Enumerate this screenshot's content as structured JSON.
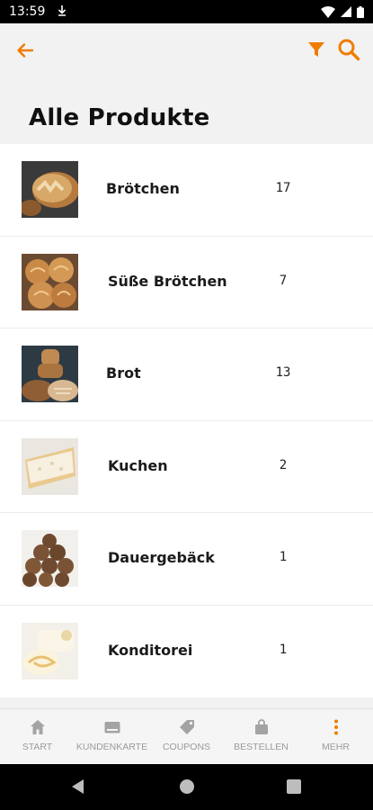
{
  "status": {
    "time": "13:59",
    "download_icon": "download-icon"
  },
  "colors": {
    "accent": "#f07c00",
    "title": "#111111"
  },
  "header": {
    "title": "Alle Produkte"
  },
  "categories": [
    {
      "label": "Brötchen",
      "count": "17",
      "image": "bread-rolls"
    },
    {
      "label": "Süße Brötchen",
      "count": "7",
      "image": "sweet-buns"
    },
    {
      "label": "Brot",
      "count": "13",
      "image": "bread-loaves"
    },
    {
      "label": "Kuchen",
      "count": "2",
      "image": "cake"
    },
    {
      "label": "Dauergebäck",
      "count": "1",
      "image": "cookies"
    },
    {
      "label": "Konditorei",
      "count": "1",
      "image": "pastry-roll"
    }
  ],
  "nav": {
    "items": [
      {
        "label": "START",
        "icon": "home-icon"
      },
      {
        "label": "KUNDENKARTE",
        "icon": "card-icon"
      },
      {
        "label": "COUPONS",
        "icon": "tag-icon"
      },
      {
        "label": "BESTELLEN",
        "icon": "bag-icon"
      },
      {
        "label": "MEHR",
        "icon": "more-vertical-icon"
      }
    ]
  }
}
